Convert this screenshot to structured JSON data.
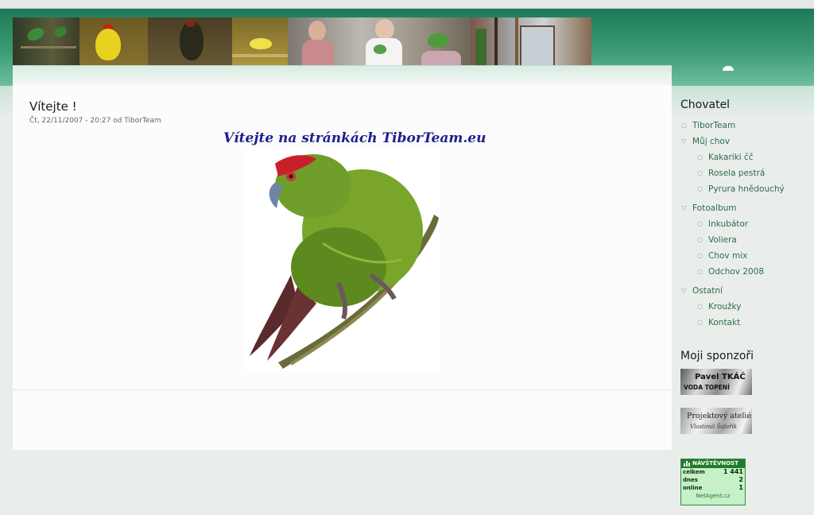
{
  "article": {
    "title": "Vítejte !",
    "meta": "Čt, 22/11/2007 - 20:27 od TiborTeam",
    "welcome_text": "Vítejte na stránkách TiborTeam.eu"
  },
  "sidebar": {
    "block_title": "Chovatel",
    "items": [
      {
        "label": "TiborTeam"
      },
      {
        "label": "Můj chov"
      },
      {
        "label": "Kakariki čč"
      },
      {
        "label": "Rosela pestrá"
      },
      {
        "label": "Pyrura hnědouchý"
      },
      {
        "label": "Fotoalbum"
      },
      {
        "label": "Inkubátor"
      },
      {
        "label": "Voliera"
      },
      {
        "label": "Chov mix"
      },
      {
        "label": "Odchov 2008"
      },
      {
        "label": "Ostatní"
      },
      {
        "label": "Kroužky"
      },
      {
        "label": "Kontakt"
      }
    ]
  },
  "sponsors": {
    "title": "Moji sponzoři",
    "sponsor1": {
      "line1": "Pavel TKÁČ",
      "line2": "VODA TOPENÍ"
    },
    "sponsor2": {
      "line1": "Projektový ateliér",
      "line2": "Vlastimil Šafařík"
    }
  },
  "counter": {
    "title": "NÁVŠTĚVNOST",
    "rows": [
      {
        "label": "celkem",
        "value": "1 441"
      },
      {
        "label": "dnes",
        "value": "2"
      },
      {
        "label": "online",
        "value": "1"
      }
    ],
    "footer": "NetAgent.cz"
  },
  "colors": {
    "header_green": "#2f8c66",
    "link_green": "#2e6b50",
    "welcome_blue": "#1c1f8f"
  }
}
